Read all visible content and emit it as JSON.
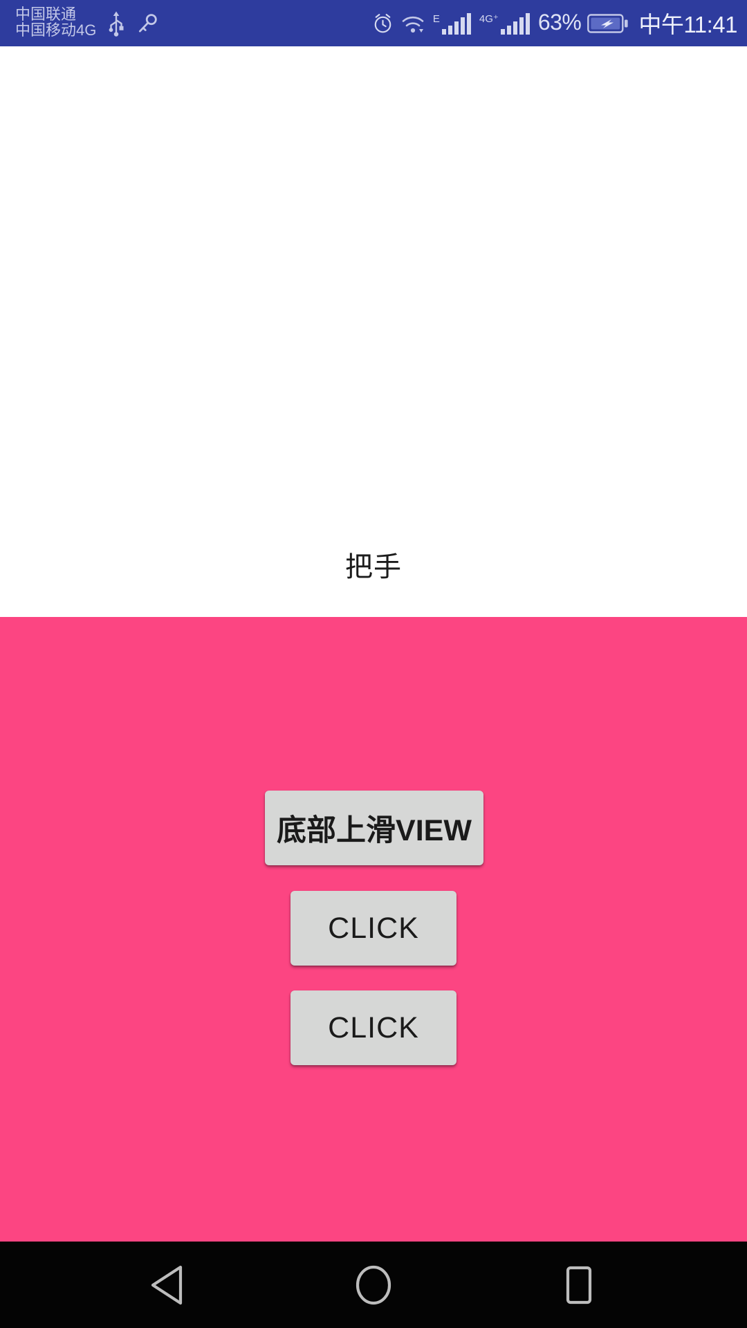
{
  "status_bar": {
    "background_color": "#2E3C9E",
    "carrier_line_1": "中国联通",
    "carrier_line_2": "中国移动4G",
    "icons_left": [
      "usb-icon",
      "vpn-key-icon"
    ],
    "icons_right": [
      "alarm-icon",
      "wifi-icon",
      "signal-e-icon",
      "signal-4gplus-icon",
      "battery-charging-icon"
    ],
    "network_label_1": "E",
    "network_label_2": "4G⁺",
    "battery_percent": "63%",
    "clock": "中午11:41"
  },
  "drawer": {
    "handle_label": "把手",
    "panel_background": "#FFFFFF"
  },
  "sliding_panel": {
    "background_color": "#FC4582",
    "buttons": [
      {
        "id": "slide-view",
        "label": "底部上滑VIEW"
      },
      {
        "id": "click-1",
        "label": "CLICK"
      },
      {
        "id": "click-2",
        "label": "CLICK"
      }
    ],
    "button_color": "#D6D7D6",
    "button_text_color": "#1A1A1A"
  },
  "nav_bar": {
    "background_color": "#040404",
    "items": [
      {
        "name": "back",
        "icon": "triangle-left-icon"
      },
      {
        "name": "home",
        "icon": "circle-icon"
      },
      {
        "name": "recents",
        "icon": "square-icon"
      }
    ]
  }
}
